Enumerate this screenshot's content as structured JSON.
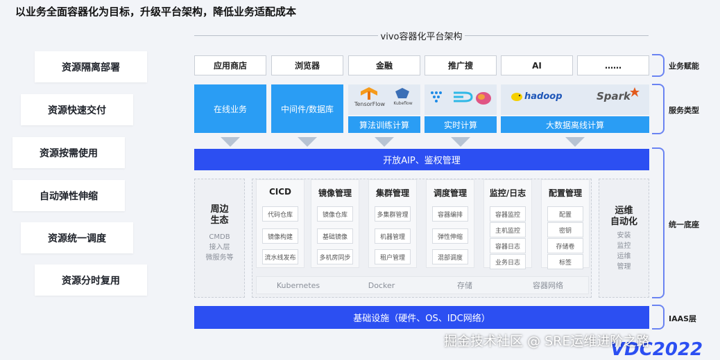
{
  "page_title": "以业务全面容器化为目标，升级平台架构，降低业务适配成本",
  "platform_title": "vivo容器化平台架构",
  "left_items": [
    "资源隔离部署",
    "资源快速交付",
    "资源按需使用",
    "自动弹性伸缩",
    "资源统一调度",
    "资源分时复用"
  ],
  "business_apps": [
    "应用商店",
    "浏览器",
    "金融",
    "推广搜",
    "AI",
    "……"
  ],
  "services": {
    "online": "在线业务",
    "middleware": "中间件/数据库",
    "ml": "算法训练计算",
    "realtime": "实时计算",
    "bigdata": "大数据离线计算",
    "logos": {
      "tensorflow": "TensorFlow",
      "kubeflow": "Kubeflow",
      "hadoop": "hadoop",
      "spark": "Spark"
    }
  },
  "api_bar": "开放AIP、鉴权管理",
  "ecosystem": {
    "title_1": "周边",
    "title_2": "生态",
    "items": [
      "CMDB",
      "接入层",
      "微服务等"
    ]
  },
  "columns": [
    {
      "title": "CICD",
      "items": [
        "代码仓库",
        "镜像构建",
        "流水线发布"
      ]
    },
    {
      "title": "镜像管理",
      "items": [
        "镜像仓库",
        "基础镜像",
        "多机房同步"
      ]
    },
    {
      "title": "集群管理",
      "items": [
        "多集群管理",
        "机器管理",
        "租户管理"
      ]
    },
    {
      "title": "调度管理",
      "items": [
        "容器编排",
        "弹性伸缩",
        "混部调度"
      ]
    },
    {
      "title": "监控/日志",
      "items": [
        "容器监控",
        "主机监控",
        "容器日志",
        "业务日志"
      ]
    },
    {
      "title": "配置管理",
      "items": [
        "配置",
        "密钥",
        "存储卷",
        "标签"
      ]
    }
  ],
  "ops": {
    "title_1": "运维",
    "title_2": "自动化",
    "items": [
      "安装",
      "监控",
      "运维",
      "管理"
    ]
  },
  "infra_row": [
    "Kubernetes",
    "Docker",
    "存储",
    "容器网络"
  ],
  "base_bar": "基础设施（硬件、OS、IDC网络）",
  "right_labels": [
    "业务赋能",
    "服务类型",
    "统一底座",
    "IAAS层"
  ],
  "watermark": "掘金技术社区 @ SRE运维进阶之路",
  "deco_text": "VDC2022",
  "colors": {
    "primary_blue": "#2c4ff2",
    "service_blue": "#2a9df4",
    "bracket": "#6a83f2"
  }
}
